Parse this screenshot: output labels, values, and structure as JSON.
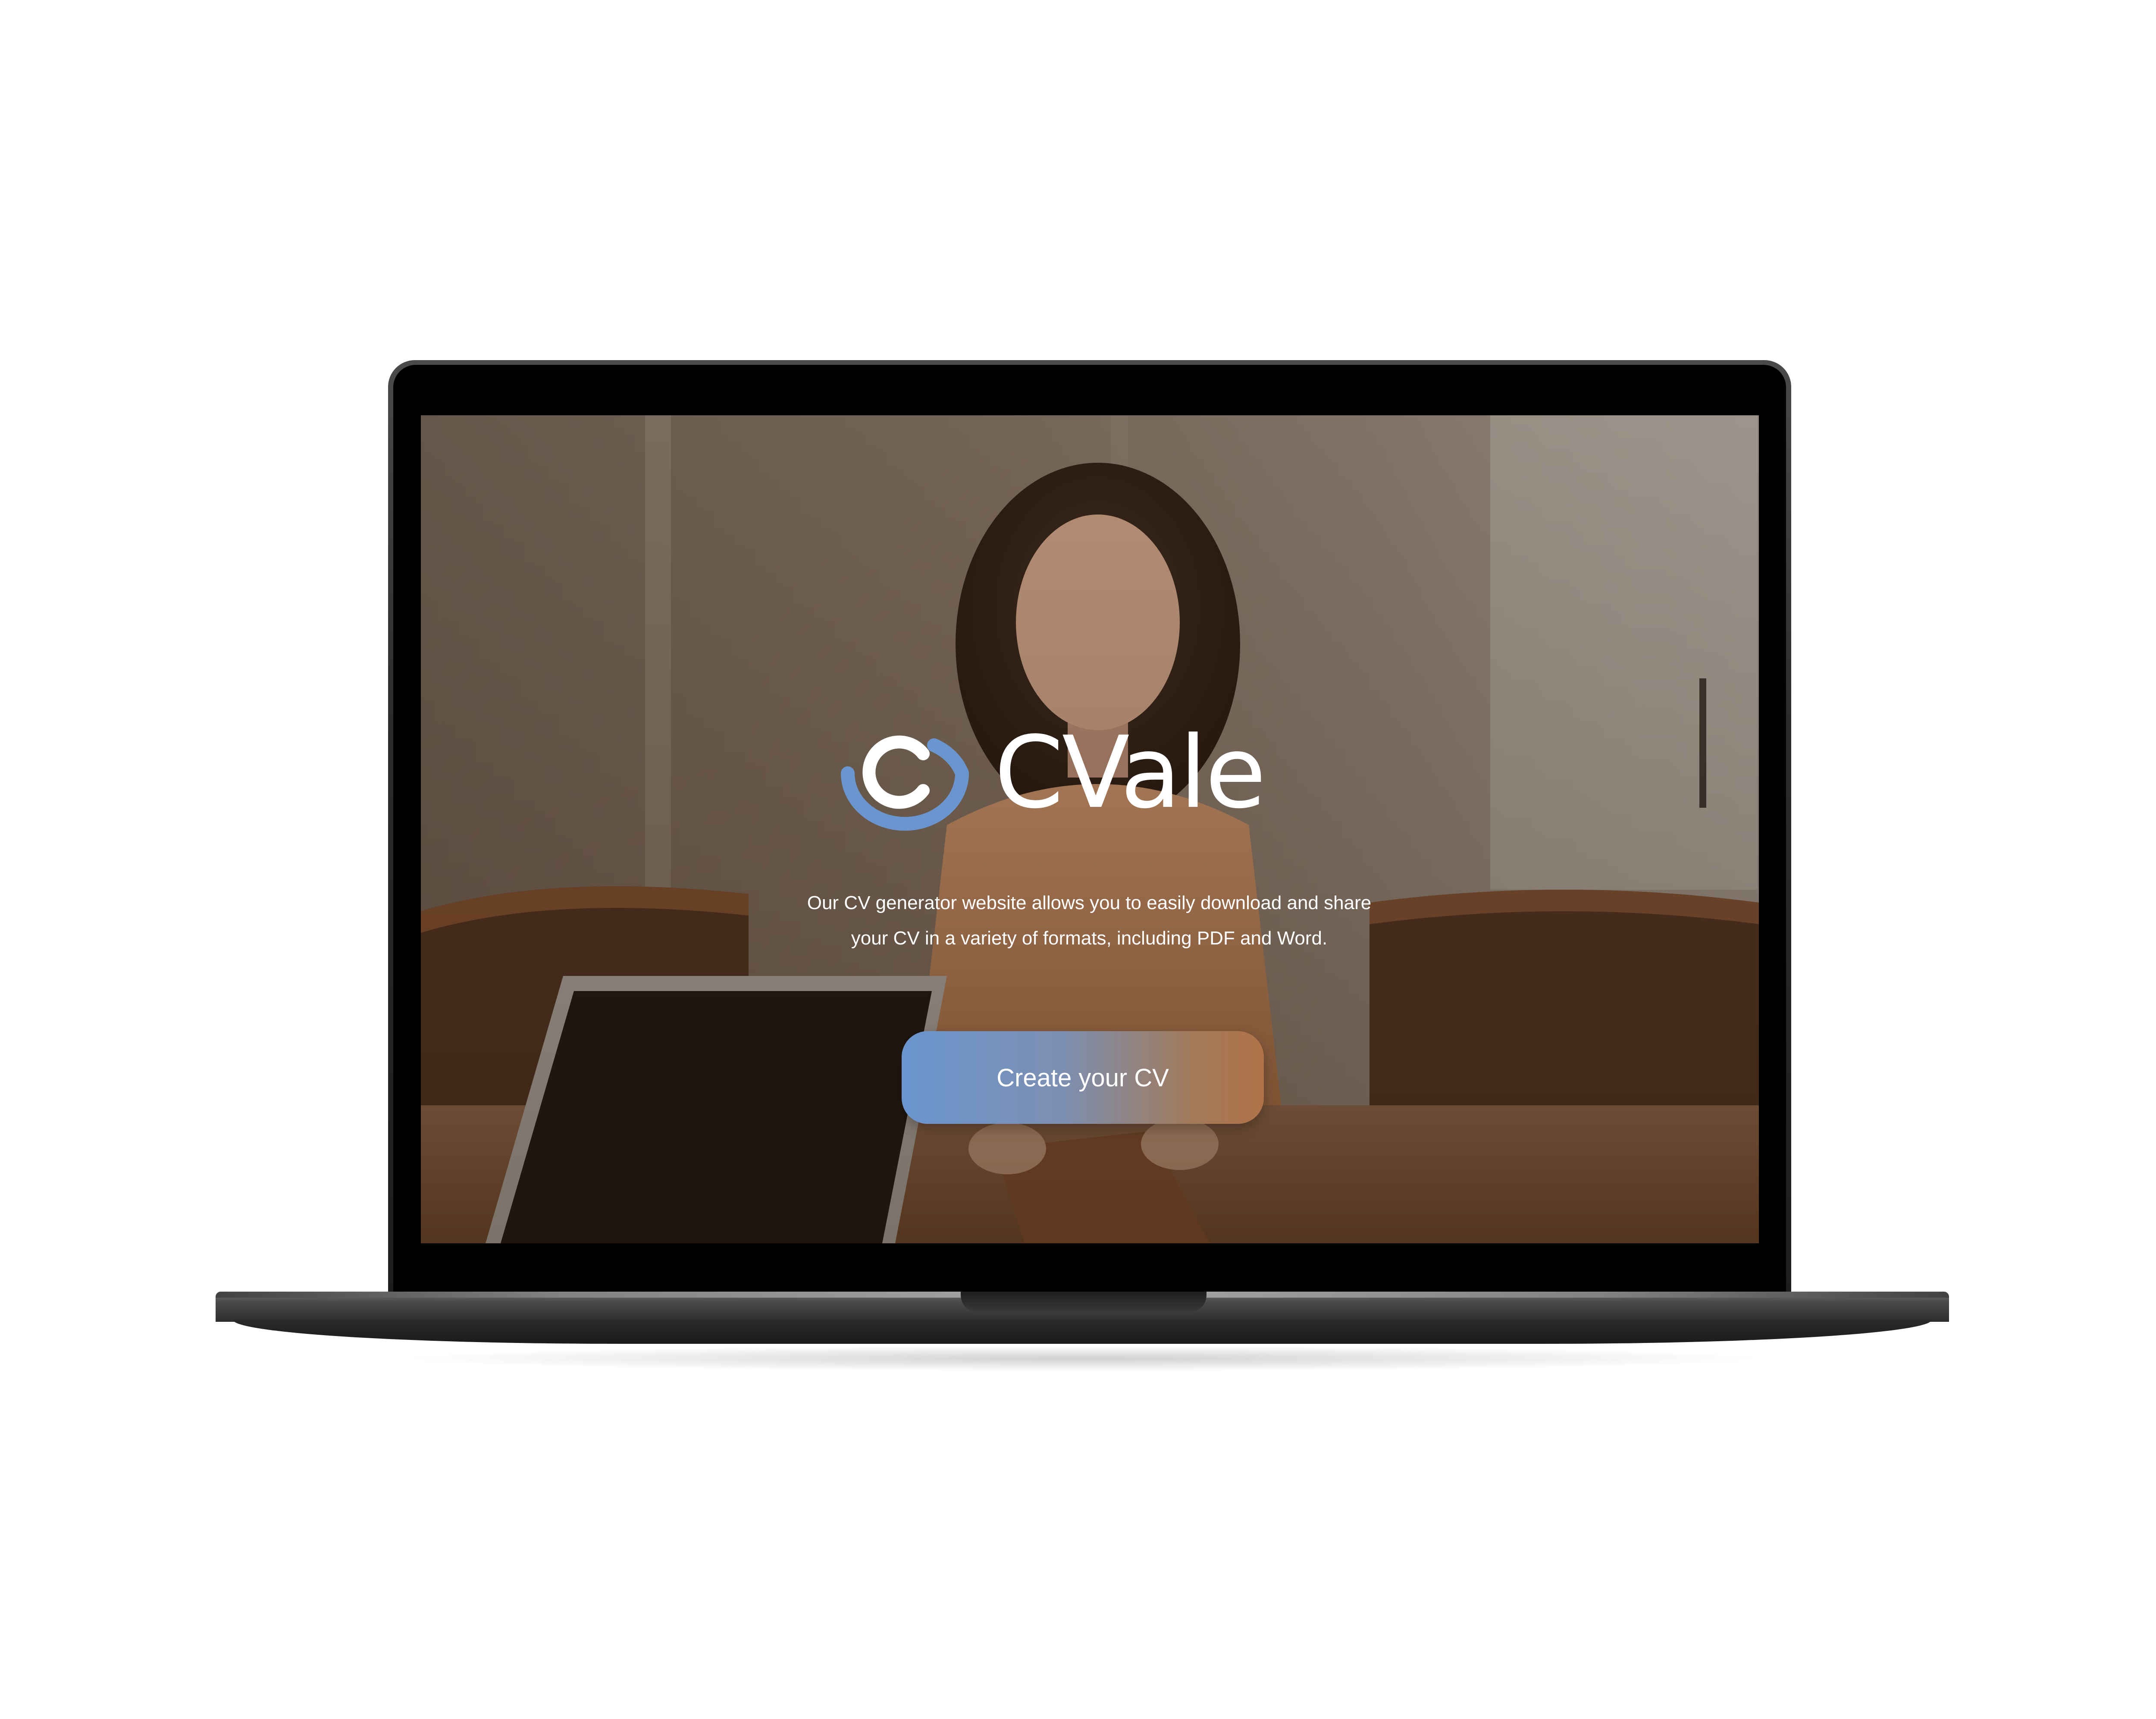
{
  "hero": {
    "brand_name": "CVale",
    "logo_icon": "cvalue-logo-icon",
    "tagline_line1": "Our CV generator website allows you to easily download and share",
    "tagline_line2": "your CV in a variety of formats, including PDF and Word.",
    "cta_label": "Create your CV"
  },
  "colors": {
    "logo_blue": "#6a95cf",
    "logo_blue_light": "#8fb2e0",
    "cta_start": "#6a95cf",
    "cta_end": "#b07348",
    "text": "#ffffff"
  }
}
